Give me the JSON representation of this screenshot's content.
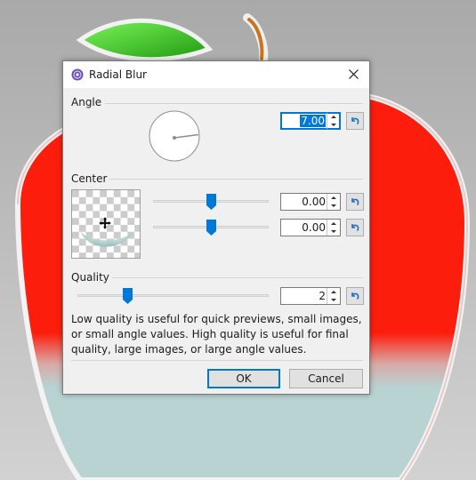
{
  "dialog": {
    "title": "Radial Blur",
    "close_label": "×"
  },
  "angle": {
    "label": "Angle",
    "value": "7.00"
  },
  "center": {
    "label": "Center",
    "x_value": "0.00",
    "y_value": "0.00",
    "x_slider_fraction": 0.5,
    "y_slider_fraction": 0.5
  },
  "quality": {
    "label": "Quality",
    "value": "2",
    "slider_fraction": 0.25
  },
  "help_text": "Low quality is useful for quick previews, small images, or small angle values. High quality is useful for final quality, large images, or large angle values.",
  "buttons": {
    "ok_label": "OK",
    "cancel_label": "Cancel"
  },
  "colors": {
    "accent": "#0078d7",
    "apple_red": "#ff1a0a",
    "apple_leaf": "#36c21a",
    "apple_bottom": "#b9d3d3"
  }
}
